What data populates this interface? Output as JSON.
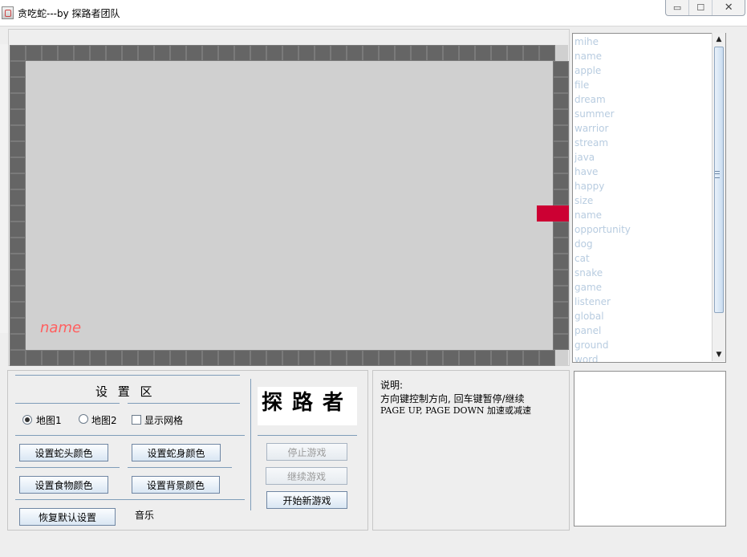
{
  "window": {
    "title": "贪吃蛇---by 探路者团队",
    "min_icon": "minimize-icon",
    "max_icon": "maximize-icon",
    "close_icon": "close-icon"
  },
  "game": {
    "food_label": "name",
    "colors": {
      "board": "#d0d0d0",
      "wall": "#656565",
      "snake": "#cc0033",
      "food_label": "#ff5f5f"
    }
  },
  "word_list": [
    "mihe",
    "name",
    "apple",
    "file",
    "dream",
    "summer",
    "warrior",
    "stream",
    "java",
    "have",
    "happy",
    "size",
    "name",
    "opportunity",
    "dog",
    "cat",
    "snake",
    "game",
    "listener",
    "global",
    "panel",
    "ground",
    "word"
  ],
  "settings": {
    "title": "设 置 区",
    "map1_label": "地图1",
    "map2_label": "地图2",
    "show_grid_label": "显示网格",
    "snake_head_color": "设置蛇头颜色",
    "snake_body_color": "设置蛇身颜色",
    "food_color": "设置食物颜色",
    "background_color": "设置背景颜色",
    "restore_default": "恢复默认设置",
    "music_label": "音乐"
  },
  "logo": {
    "text": "探路者"
  },
  "controls": {
    "stop_game": "停止游戏",
    "continue_game": "继续游戏",
    "new_game": "开始新游戏"
  },
  "info": {
    "title": "说明:",
    "line1": "方向键控制方向, 回车键暂停/继续",
    "line2": "PAGE UP, PAGE DOWN 加速或减速"
  }
}
